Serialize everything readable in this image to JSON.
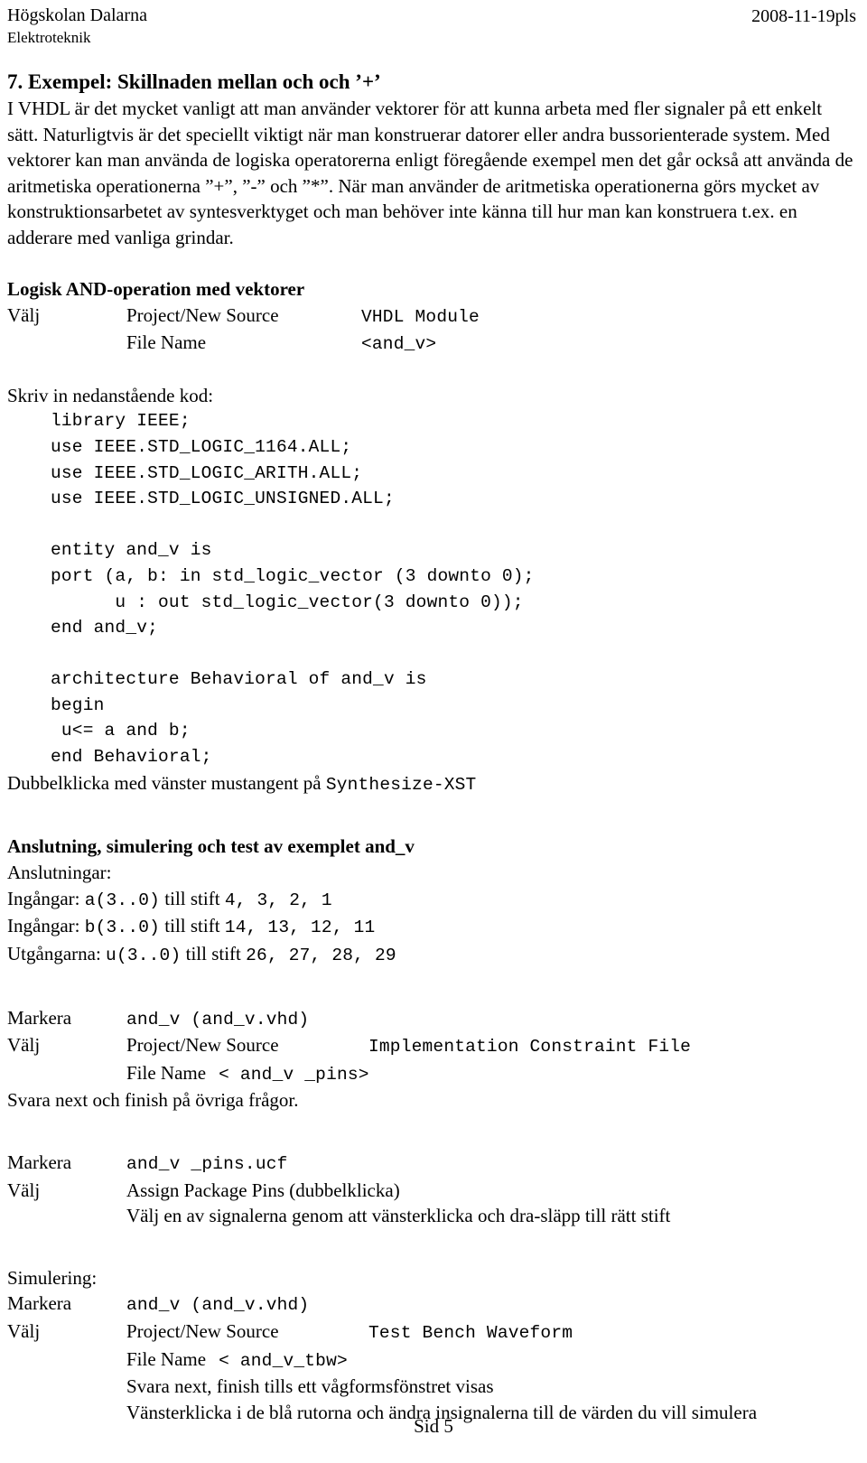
{
  "header": {
    "organisation": "Högskolan Dalarna",
    "department": "Elektroteknik",
    "date": "2008-11-19pls"
  },
  "section": {
    "heading": "7. Exempel: Skillnaden mellan och och ’+’",
    "intro_paragraph": "I VHDL är det mycket vanligt att man använder vektorer för att kunna arbeta med fler signaler på ett enkelt sätt. Naturligtvis är det speciellt viktigt när man konstruerar datorer eller andra bussorienterade system. Med vektorer kan man använda de logiska operatorerna enligt föregående exempel men det går också att använda de aritmetiska operationerna ”+”, ”-” och ”*”. När man använder de aritmetiska operationerna görs mycket av konstruktionsarbetet av syntesverktyget och man behöver inte känna till hur man kan konstruera t.ex. en adderare med vanliga grindar."
  },
  "and_operation": {
    "heading": "Logisk AND-operation med vektorer",
    "rows": [
      {
        "action": "Välj",
        "item": "Project/New Source",
        "value": "VHDL Module"
      },
      {
        "action": "",
        "item": "File Name",
        "value": "<and_v>"
      }
    ]
  },
  "code": {
    "prompt": "Skriv in nedanstående kod:",
    "lines": [
      "library IEEE;",
      "use IEEE.STD_LOGIC_1164.ALL;",
      "use IEEE.STD_LOGIC_ARITH.ALL;",
      "use IEEE.STD_LOGIC_UNSIGNED.ALL;",
      "",
      "entity and_v is",
      "port (a, b: in std_logic_vector (3 downto 0);",
      "      u : out std_logic_vector(3 downto 0));",
      "end and_v;",
      "",
      "architecture Behavioral of and_v is",
      "begin",
      " u<= a and b;",
      "end Behavioral;"
    ],
    "synthesize_prefix": "Dubbelklicka med vänster mustangent på ",
    "synthesize_target": "Synthesize-XST"
  },
  "connection": {
    "heading": "Anslutning, simulering och test av exemplet and_v",
    "subheading": "Anslutningar:",
    "lines": [
      {
        "label": "Ingångar: ",
        "signal": "a(3..0)",
        "mid": " till stift ",
        "pins": "4, 3, 2, 1"
      },
      {
        "label": "Ingångar: ",
        "signal": "b(3..0)",
        "mid": " till stift ",
        "pins": "14, 13, 12, 11"
      },
      {
        "label": "Utgångarna: ",
        "signal": "u(3..0)",
        "mid": " till stift ",
        "pins": "26, 27, 28, 29"
      }
    ]
  },
  "ucf_block": {
    "rows": [
      {
        "action": "Markera",
        "item": "",
        "value": "and_v (and_v.vhd)"
      },
      {
        "action": "Välj",
        "item": "Project/New Source",
        "value": "Implementation Constraint File"
      },
      {
        "action": "",
        "item": "File Name",
        "value": "< and_v _pins>"
      }
    ],
    "note": "Svara next och finish på övriga frågor."
  },
  "pins_block": {
    "rows": [
      {
        "action": "Markera",
        "item": "",
        "value": "and_v _pins.ucf"
      },
      {
        "action": "Välj",
        "item": "Assign Package Pins (dubbelklicka)",
        "value": ""
      },
      {
        "action": "",
        "item": "Välj en av signalerna genom att vänsterklicka och dra-släpp till rätt stift",
        "value": ""
      }
    ]
  },
  "simulation": {
    "heading": "Simulering:",
    "rows": [
      {
        "action": "Markera",
        "item": "",
        "value": "and_v (and_v.vhd)"
      },
      {
        "action": "Välj",
        "item": "Project/New Source",
        "value": "Test Bench Waveform"
      },
      {
        "action": "",
        "item": "File Name",
        "value": "< and_v_tbw>"
      }
    ],
    "notes": [
      "Svara next, finish tills ett vågformsfönstret visas",
      "Vänsterklicka i de blå rutorna och ändra insignalerna till de värden du vill simulera"
    ]
  },
  "footer": {
    "page_label": "Sid 5"
  }
}
